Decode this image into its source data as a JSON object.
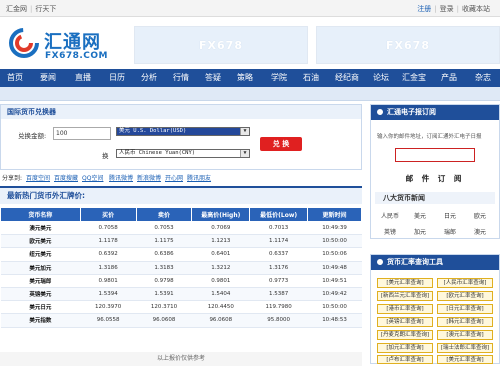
{
  "topbar": {
    "left_links": [
      "汇金网",
      "行天下"
    ],
    "right_links": [
      "注册",
      "登录",
      "收藏本站"
    ]
  },
  "logo": {
    "name": "汇通网",
    "url": "FX678.COM"
  },
  "header_ads": [
    "FX678",
    "FX678"
  ],
  "nav": {
    "items": [
      "首页",
      "要闻",
      "直播",
      "日历",
      "分析",
      "行情",
      "答疑",
      "策略",
      "学院",
      "石油",
      "经纪商",
      "论坛",
      "汇金宝",
      "产品",
      "杂志"
    ]
  },
  "converter": {
    "title": "国际货币兑换器",
    "amount_label": "兑换金额:",
    "amount_value": "100",
    "from_currency": "美元 U.S. Dollar(USD)",
    "swap_label": "换",
    "to_currency": "人民币 Chinese Yuan(CNY)",
    "convert_button": "兑 换"
  },
  "quick_links": {
    "label": "分享到:",
    "items": [
      "百度空间",
      "百度搜藏",
      "QQ空间",
      "腾讯微博",
      "新浪微博",
      "开心网",
      "腾讯朋友"
    ]
  },
  "rates": {
    "title": "最新热门货币外汇牌价:",
    "headers": [
      "货币名称",
      "买价",
      "卖价",
      "最高价(High)",
      "最低价(Low)",
      "更新时间"
    ],
    "rows": [
      [
        "澳元美元",
        "0.7058",
        "0.7053",
        "0.7069",
        "0.7013",
        "10:49:39"
      ],
      [
        "欧元美元",
        "1.1178",
        "1.1175",
        "1.1213",
        "1.1174",
        "10:50:00"
      ],
      [
        "纽元美元",
        "0.6392",
        "0.6386",
        "0.6401",
        "0.6337",
        "10:50:06"
      ],
      [
        "美元加元",
        "1.3186",
        "1.3183",
        "1.3212",
        "1.3176",
        "10:49:48"
      ],
      [
        "美元瑞郎",
        "0.9801",
        "0.9798",
        "0.9801",
        "0.9773",
        "10:49:51"
      ],
      [
        "英镑美元",
        "1.5394",
        "1.5391",
        "1.5404",
        "1.5387",
        "10:49:42"
      ],
      [
        "美元日元",
        "120.3970",
        "120.3710",
        "120.4450",
        "119.7980",
        "10:50:00"
      ],
      [
        "美元指数",
        "96.0558",
        "96.0608",
        "96.0608",
        "95.8000",
        "10:48:53"
      ]
    ],
    "footer": "以上报价仅供参考"
  },
  "sidebar": {
    "mail_title": "汇通电子报订阅",
    "mail_hint": "输入你的邮件地址，订阅汇通外汇电子日报",
    "subscribe_label": "邮 件 订 阅",
    "news_title": "八大货币新闻",
    "currencies": [
      "人民币",
      "美元",
      "日元",
      "欧元",
      "英镑",
      "加元",
      "瑞郎",
      "澳元"
    ],
    "tools_title": "货币汇率查询工具",
    "tools": [
      "[美元汇率查询]",
      "[人民币汇率查询]",
      "[新西兰元汇率查询]",
      "[欧元汇率查询]",
      "[港币汇率查询]",
      "[日元汇率查询]",
      "[英镑汇率查询]",
      "[韩元汇率查询]",
      "[丹麦克朗汇率查询]",
      "[澳元汇率查询]",
      "[加元汇率查询]",
      "[瑞士法郎汇率查询]",
      "[卢布汇率查询]",
      "[美元汇率查询]"
    ]
  },
  "colors": {
    "nav_bg": "#1f4f9a",
    "table_head": "#2a63b8",
    "accent_red": "#e02020",
    "link_blue": "#1a5fb4"
  }
}
